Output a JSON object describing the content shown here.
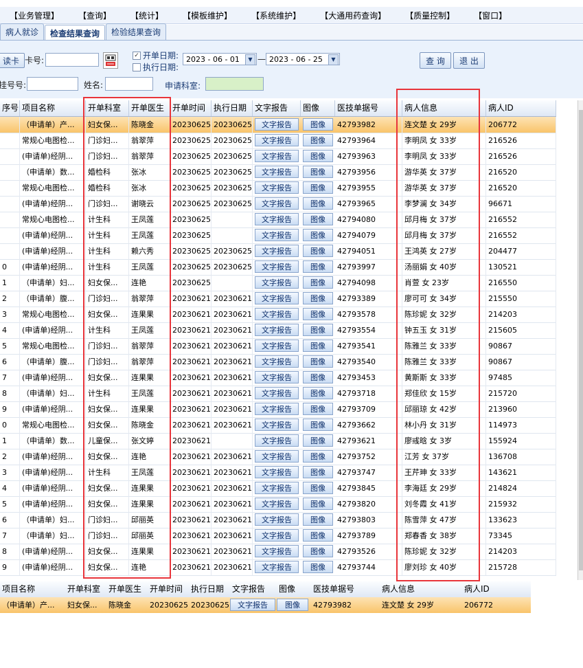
{
  "menu": [
    "【业务管理】",
    "【查询】",
    "【统计】",
    "【模板维护】",
    "【系统维护】",
    "【大通用药查询】",
    "【质量控制】",
    "【窗口】"
  ],
  "tabs": [
    "病人就诊",
    "检查结果查询",
    "检验结果查询"
  ],
  "search": {
    "read_card": "读卡",
    "card_label": "卡号:",
    "open_date_label": "开单日期:",
    "exec_date_label": "执行日期:",
    "date_from": "2023 - 06 - 01",
    "date_sep": "—",
    "date_to": "2023 - 06 - 25",
    "reg_label": "挂号号:",
    "name_label": "姓名:",
    "dept_label": "申请科室:",
    "query_button": "查 询",
    "exit_button": "退 出"
  },
  "columns": [
    "序号",
    "项目名称",
    "开单科室",
    "开单医生",
    "开单时间",
    "执行日期",
    "文字报告",
    "图像",
    "医技单据号",
    "病人信息",
    "病人ID"
  ],
  "text_report_label": "文字报告",
  "image_label": "图像",
  "rows": [
    {
      "no": "",
      "item": "（申请单）产...",
      "dept": "妇女保...",
      "doc": "陈晓金",
      "open": "20230625",
      "exec": "20230625",
      "bill": "42793982",
      "info": "连文楚 女 29岁",
      "pid": "206772"
    },
    {
      "no": "",
      "item": "常规心电图检...",
      "dept": "门诊妇...",
      "doc": "翁翠萍",
      "open": "20230625",
      "exec": "20230625",
      "bill": "42793964",
      "info": "李明凤 女 33岁",
      "pid": "216526"
    },
    {
      "no": "",
      "item": "(申请单)经阴...",
      "dept": "门诊妇...",
      "doc": "翁翠萍",
      "open": "20230625",
      "exec": "20230625",
      "bill": "42793963",
      "info": "李明凤 女 33岁",
      "pid": "216526"
    },
    {
      "no": "",
      "item": "（申请单）数...",
      "dept": "婚检科",
      "doc": "张冰",
      "open": "20230625",
      "exec": "20230625",
      "bill": "42793956",
      "info": "游华英 女 37岁",
      "pid": "216520"
    },
    {
      "no": "",
      "item": "常规心电图检...",
      "dept": "婚检科",
      "doc": "张冰",
      "open": "20230625",
      "exec": "20230625",
      "bill": "42793955",
      "info": "游华英 女 37岁",
      "pid": "216520"
    },
    {
      "no": "",
      "item": "(申请单)经阴...",
      "dept": "门诊妇...",
      "doc": "谢晓云",
      "open": "20230625",
      "exec": "20230625",
      "bill": "42793965",
      "info": "李梦澜 女 34岁",
      "pid": "96671"
    },
    {
      "no": "",
      "item": "常规心电图检...",
      "dept": "计生科",
      "doc": "王凤莲",
      "open": "20230625",
      "exec": "",
      "bill": "42794080",
      "info": "邱月梅 女 37岁",
      "pid": "216552"
    },
    {
      "no": "",
      "item": "(申请单)经阴...",
      "dept": "计生科",
      "doc": "王凤莲",
      "open": "20230625",
      "exec": "",
      "bill": "42794079",
      "info": "邱月梅 女 37岁",
      "pid": "216552"
    },
    {
      "no": "",
      "item": "(申请单)经阴...",
      "dept": "计生科",
      "doc": "赖六秀",
      "open": "20230625",
      "exec": "20230625",
      "bill": "42794051",
      "info": "王鸿英 女 27岁",
      "pid": "204477"
    },
    {
      "no": "0",
      "item": "(申请单)经阴...",
      "dept": "计生科",
      "doc": "王凤莲",
      "open": "20230625",
      "exec": "20230625",
      "bill": "42793997",
      "info": "汤丽娟 女 40岁",
      "pid": "130521"
    },
    {
      "no": "1",
      "item": "（申请单）妇...",
      "dept": "妇女保...",
      "doc": "连艳",
      "open": "20230625",
      "exec": "",
      "bill": "42794098",
      "info": "肖萱 女 23岁",
      "pid": "216550"
    },
    {
      "no": "2",
      "item": "（申请单）腹...",
      "dept": "门诊妇...",
      "doc": "翁翠萍",
      "open": "20230621",
      "exec": "20230621",
      "bill": "42793389",
      "info": "廖可可 女 34岁",
      "pid": "215550"
    },
    {
      "no": "3",
      "item": "常规心电图检...",
      "dept": "妇女保...",
      "doc": "连果果",
      "open": "20230621",
      "exec": "20230621",
      "bill": "42793578",
      "info": "陈珍妮 女 32岁",
      "pid": "214203"
    },
    {
      "no": "4",
      "item": "(申请单)经阴...",
      "dept": "计生科",
      "doc": "王凤莲",
      "open": "20230621",
      "exec": "20230621",
      "bill": "42793554",
      "info": "钟五玉 女 31岁",
      "pid": "215605"
    },
    {
      "no": "5",
      "item": "常规心电图检...",
      "dept": "门诊妇...",
      "doc": "翁翠萍",
      "open": "20230621",
      "exec": "20230621",
      "bill": "42793541",
      "info": "陈雅兰 女 33岁",
      "pid": "90867"
    },
    {
      "no": "6",
      "item": "（申请单）腹...",
      "dept": "门诊妇...",
      "doc": "翁翠萍",
      "open": "20230621",
      "exec": "20230621",
      "bill": "42793540",
      "info": "陈雅兰 女 33岁",
      "pid": "90867"
    },
    {
      "no": "7",
      "item": "(申请单)经阴...",
      "dept": "妇女保...",
      "doc": "连果果",
      "open": "20230621",
      "exec": "20230621",
      "bill": "42793453",
      "info": "黄斯斯 女 33岁",
      "pid": "97485"
    },
    {
      "no": "8",
      "item": "（申请单）妇...",
      "dept": "计生科",
      "doc": "王凤莲",
      "open": "20230621",
      "exec": "20230621",
      "bill": "42793718",
      "info": "郑佳欣 女 15岁",
      "pid": "215720"
    },
    {
      "no": "9",
      "item": "(申请单)经阴...",
      "dept": "妇女保...",
      "doc": "连果果",
      "open": "20230621",
      "exec": "20230621",
      "bill": "42793709",
      "info": "邱丽琼 女 42岁",
      "pid": "213960"
    },
    {
      "no": "0",
      "item": "常规心电图检...",
      "dept": "妇女保...",
      "doc": "陈晓金",
      "open": "20230621",
      "exec": "20230621",
      "bill": "42793662",
      "info": "林小丹 女 31岁",
      "pid": "114973"
    },
    {
      "no": "1",
      "item": "（申请单）数...",
      "dept": "儿童保...",
      "doc": "张文婷",
      "open": "20230621",
      "exec": "",
      "bill": "42793621",
      "info": "廖彧晗 女 3岁",
      "pid": "155924"
    },
    {
      "no": "2",
      "item": "(申请单)经阴...",
      "dept": "妇女保...",
      "doc": "连艳",
      "open": "20230621",
      "exec": "20230621",
      "bill": "42793752",
      "info": "江芳 女 37岁",
      "pid": "136708"
    },
    {
      "no": "3",
      "item": "(申请单)经阴...",
      "dept": "计生科",
      "doc": "王凤莲",
      "open": "20230621",
      "exec": "20230621",
      "bill": "42793747",
      "info": "王芹珅 女 33岁",
      "pid": "143621"
    },
    {
      "no": "4",
      "item": "(申请单)经阴...",
      "dept": "妇女保...",
      "doc": "连果果",
      "open": "20230621",
      "exec": "20230621",
      "bill": "42793845",
      "info": "李海廷 女 29岁",
      "pid": "214824"
    },
    {
      "no": "5",
      "item": "(申请单)经阴...",
      "dept": "妇女保...",
      "doc": "连果果",
      "open": "20230621",
      "exec": "20230621",
      "bill": "42793820",
      "info": "刘冬霞 女 41岁",
      "pid": "215932"
    },
    {
      "no": "6",
      "item": "（申请单）妇...",
      "dept": "门诊妇...",
      "doc": "邱丽英",
      "open": "20230621",
      "exec": "20230621",
      "bill": "42793803",
      "info": "陈雪萍 女 47岁",
      "pid": "133623"
    },
    {
      "no": "7",
      "item": "（申请单）妇...",
      "dept": "门诊妇...",
      "doc": "邱丽英",
      "open": "20230621",
      "exec": "20230621",
      "bill": "42793789",
      "info": "郑春香 女 38岁",
      "pid": "73345"
    },
    {
      "no": "8",
      "item": "(申请单)经阴...",
      "dept": "妇女保...",
      "doc": "连果果",
      "open": "20230621",
      "exec": "20230621",
      "bill": "42793526",
      "info": "陈珍妮 女 32岁",
      "pid": "214203"
    },
    {
      "no": "9",
      "item": "(申请单)经阴...",
      "dept": "妇女保...",
      "doc": "连艳",
      "open": "20230621",
      "exec": "20230621",
      "bill": "42793744",
      "info": "廖刘珍 女 40岁",
      "pid": "215728"
    }
  ],
  "footer": {
    "columns": [
      "项目名称",
      "开单科室",
      "开单医生",
      "开单时间",
      "执行日期",
      "文字报告",
      "图像",
      "医技单据号",
      "病人信息",
      "病人ID"
    ],
    "row": {
      "item": "（申请单）产...",
      "dept": "妇女保...",
      "doc": "陈晓金",
      "open": "20230625",
      "exec": "20230625",
      "bill": "42793982",
      "info": "连文楚 女 29岁",
      "pid": "206772"
    }
  },
  "colors": {
    "selected_row": "#f9c46a",
    "highlight_box": "#e8343a",
    "header_bg": "#dfe8f5",
    "dept_field": "#d8f0c8"
  }
}
